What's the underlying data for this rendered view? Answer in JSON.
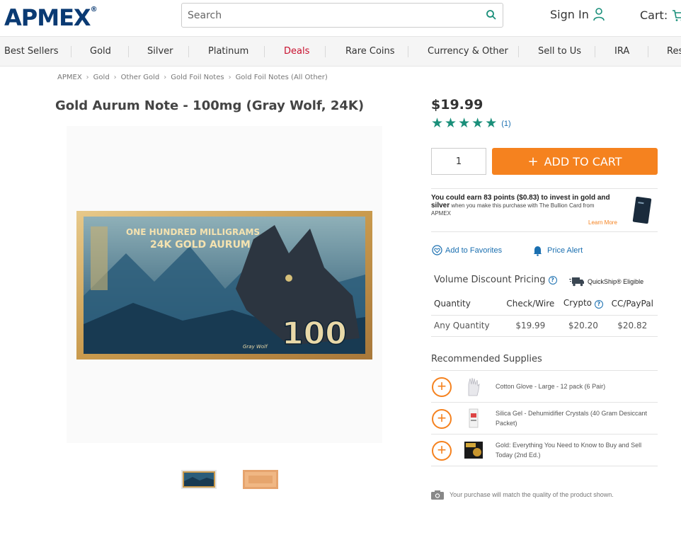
{
  "header": {
    "logo": "APMEX",
    "logo_reg": "®",
    "search_placeholder": "Search",
    "sign_in": "Sign In",
    "cart": "Cart:"
  },
  "nav": {
    "items": [
      "Best Sellers",
      "Gold",
      "Silver",
      "Platinum",
      "Deals",
      "Rare Coins",
      "Currency & Other",
      "Sell to Us",
      "IRA",
      "Res"
    ]
  },
  "breadcrumb": [
    "APMEX",
    "Gold",
    "Other Gold",
    "Gold Foil Notes",
    "Gold Foil Notes (All Other)"
  ],
  "product": {
    "title": "Gold Aurum Note - 100mg (Gray Wolf, 24K)",
    "price": "$19.99",
    "rating_count": "(1)",
    "stars": 5,
    "quantity": "1",
    "add_to_cart": "ADD TO CART",
    "note_line1": "ONE HUNDRED MILLIGRAMS",
    "note_line2": "24K GOLD AURUM",
    "note_value": "100",
    "note_caption": "Gray Wolf"
  },
  "points": {
    "headline": "You could earn 83 points ($0.83) to invest in gold and silver",
    "rest": " when you make this purchase with The Bullion Card from APMEX",
    "learn_more": "Learn More"
  },
  "actions": {
    "favorites": "Add to Favorites",
    "price_alert": "Price Alert"
  },
  "volume": {
    "title": "Volume Discount Pricing",
    "quickship": "QuickShip® Eligible",
    "headers": [
      "Quantity",
      "Check/Wire",
      "Crypto",
      "CC/PayPal"
    ],
    "rows": [
      [
        "Any Quantity",
        "$19.99",
        "$20.20",
        "$20.82"
      ]
    ]
  },
  "recommended": {
    "title": "Recommended Supplies",
    "items": [
      {
        "label": "Cotton Glove - Large - 12 pack (6 Pair)"
      },
      {
        "label": "Silica Gel - Dehumidifier Crystals (40 Gram Desiccant Packet)"
      },
      {
        "label": "Gold: Everything You Need to Know to Buy and Sell Today (2nd Ed.)"
      }
    ]
  },
  "disclaimer": "Your purchase will match the quality of the product shown.",
  "colors": {
    "brand_blue": "#0a3a73",
    "accent_orange": "#f5821f",
    "link_blue": "#1a6fb0",
    "star_teal": "#1a8f7a",
    "deals_red": "#c8102e"
  }
}
